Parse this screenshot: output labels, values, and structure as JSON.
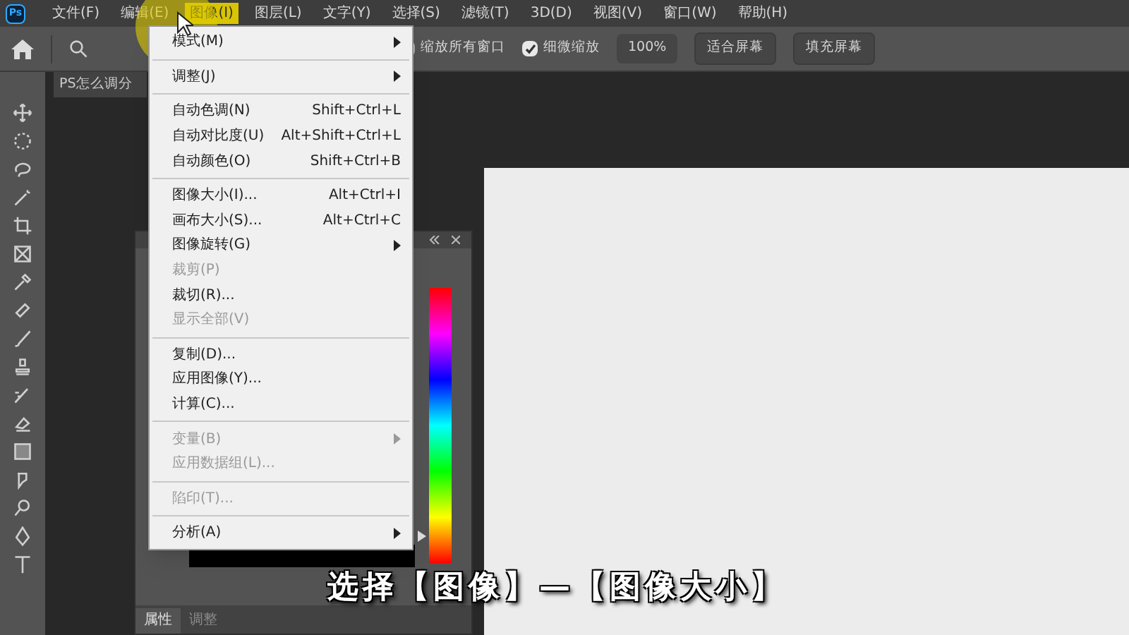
{
  "app_logo": "Ps",
  "menubar": [
    {
      "label": "文件(F)",
      "selected": false
    },
    {
      "label": "编辑(E)",
      "selected": false
    },
    {
      "label": "图像(I)",
      "selected": true
    },
    {
      "label": "图层(L)",
      "selected": false
    },
    {
      "label": "文字(Y)",
      "selected": false
    },
    {
      "label": "选择(S)",
      "selected": false
    },
    {
      "label": "滤镜(T)",
      "selected": false
    },
    {
      "label": "3D(D)",
      "selected": false
    },
    {
      "label": "视图(V)",
      "selected": false
    },
    {
      "label": "窗口(W)",
      "selected": false
    },
    {
      "label": "帮助(H)",
      "selected": false
    }
  ],
  "options_bar": {
    "checkboxes": [
      {
        "label": "缩放所有窗口",
        "checked": false
      },
      {
        "label": "细微缩放",
        "checked": true
      }
    ],
    "zoom_value": "100%",
    "buttons": [
      "适合屏幕",
      "填充屏幕"
    ]
  },
  "document_tab": {
    "title": "PS怎么调分"
  },
  "image_menu": [
    {
      "kind": "item",
      "label": "模式(M)",
      "disabled": false,
      "submenu": true
    },
    {
      "kind": "separator"
    },
    {
      "kind": "item",
      "label": "调整(J)",
      "disabled": false,
      "submenu": true
    },
    {
      "kind": "separator"
    },
    {
      "kind": "item",
      "label": "自动色调(N)",
      "shortcut": "Shift+Ctrl+L",
      "disabled": false,
      "submenu": false
    },
    {
      "kind": "item",
      "label": "自动对比度(U)",
      "shortcut": "Alt+Shift+Ctrl+L",
      "disabled": false,
      "submenu": false
    },
    {
      "kind": "item",
      "label": "自动颜色(O)",
      "shortcut": "Shift+Ctrl+B",
      "disabled": false,
      "submenu": false
    },
    {
      "kind": "separator"
    },
    {
      "kind": "item",
      "label": "图像大小(I)...",
      "shortcut": "Alt+Ctrl+I",
      "disabled": false,
      "submenu": false
    },
    {
      "kind": "item",
      "label": "画布大小(S)...",
      "shortcut": "Alt+Ctrl+C",
      "disabled": false,
      "submenu": false
    },
    {
      "kind": "item",
      "label": "图像旋转(G)",
      "disabled": false,
      "submenu": true
    },
    {
      "kind": "item",
      "label": "裁剪(P)",
      "disabled": true,
      "submenu": false
    },
    {
      "kind": "item",
      "label": "裁切(R)...",
      "disabled": false,
      "submenu": false
    },
    {
      "kind": "item",
      "label": "显示全部(V)",
      "disabled": true,
      "submenu": false
    },
    {
      "kind": "separator"
    },
    {
      "kind": "item",
      "label": "复制(D)...",
      "disabled": false,
      "submenu": false
    },
    {
      "kind": "item",
      "label": "应用图像(Y)...",
      "disabled": false,
      "submenu": false
    },
    {
      "kind": "item",
      "label": "计算(C)...",
      "disabled": false,
      "submenu": false
    },
    {
      "kind": "separator"
    },
    {
      "kind": "item",
      "label": "变量(B)",
      "disabled": true,
      "submenu": true
    },
    {
      "kind": "item",
      "label": "应用数据组(L)...",
      "disabled": true,
      "submenu": false
    },
    {
      "kind": "separator"
    },
    {
      "kind": "item",
      "label": "陷印(T)...",
      "disabled": true,
      "submenu": false
    },
    {
      "kind": "separator"
    },
    {
      "kind": "item",
      "label": "分析(A)",
      "disabled": false,
      "submenu": true
    }
  ],
  "hue_slider": {
    "level": 0.1
  },
  "panel_tabs": [
    {
      "label": "属性",
      "selected": true
    },
    {
      "label": "调整",
      "selected": false
    }
  ],
  "caption": "选择【图像】—【图像大小】"
}
